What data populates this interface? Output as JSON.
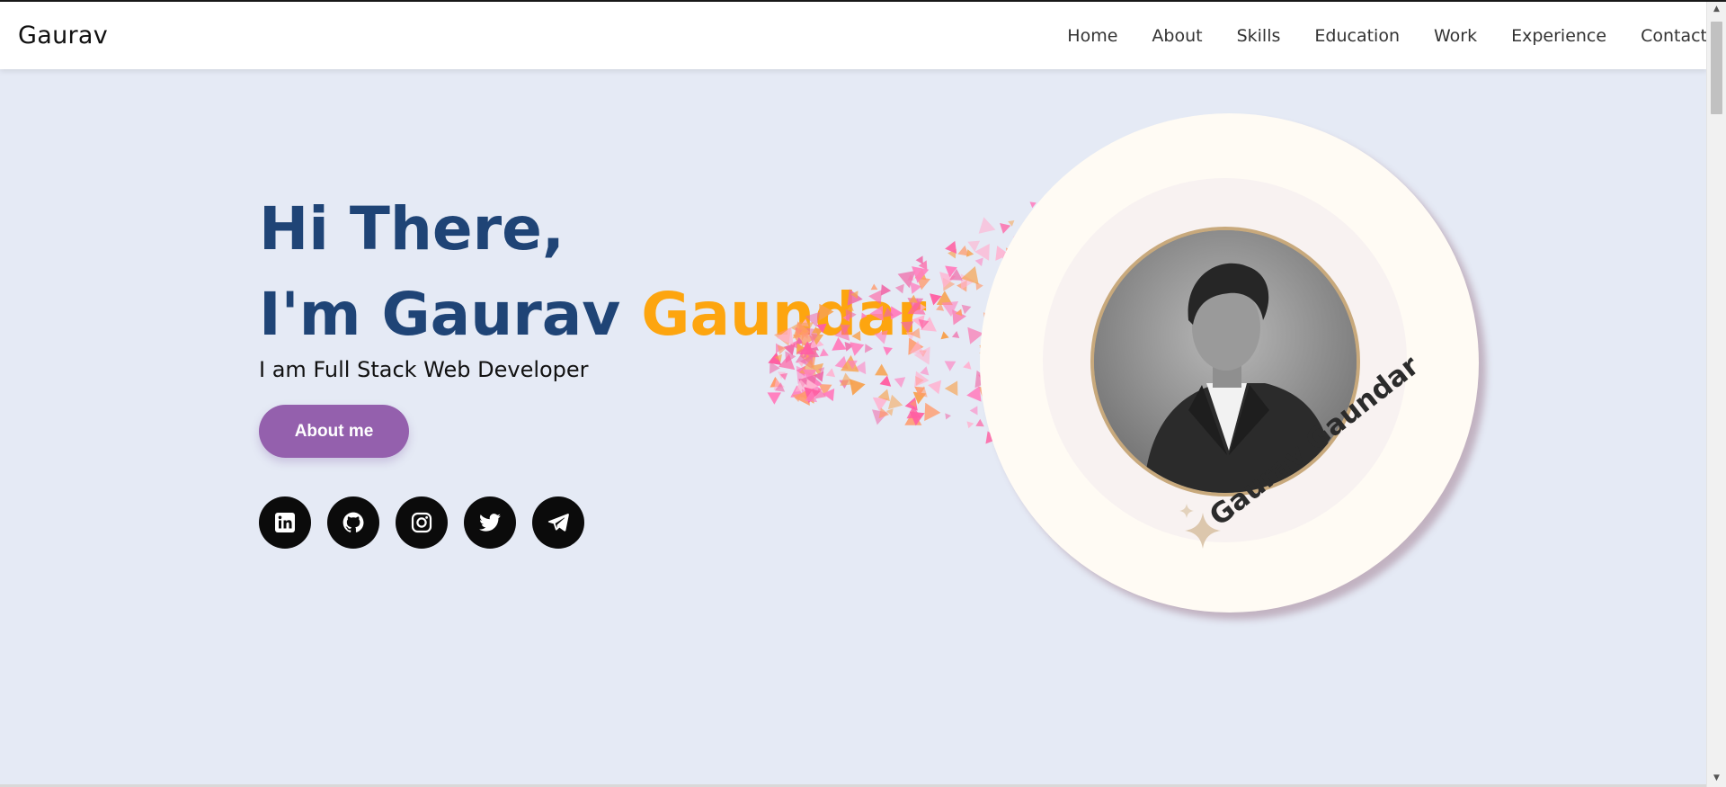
{
  "navbar": {
    "brand": "Gaurav",
    "links": [
      "Home",
      "About",
      "Skills",
      "Education",
      "Work",
      "Experience",
      "Contact"
    ]
  },
  "hero": {
    "greeting": "Hi There,",
    "name_prefix": "I'm Gaurav ",
    "name_highlight": "Gaundar",
    "subtitle": "I am Full Stack Web Developer",
    "about_button": "About me",
    "portrait_label": "Gaurav Gaundar"
  },
  "socials": [
    "linkedin-icon",
    "github-icon",
    "instagram-icon",
    "twitter-icon",
    "telegram-icon"
  ],
  "colors": {
    "background": "#e5eaf5",
    "heading": "#1f4476",
    "accent": "#fda50f",
    "button": "#9460ad"
  }
}
